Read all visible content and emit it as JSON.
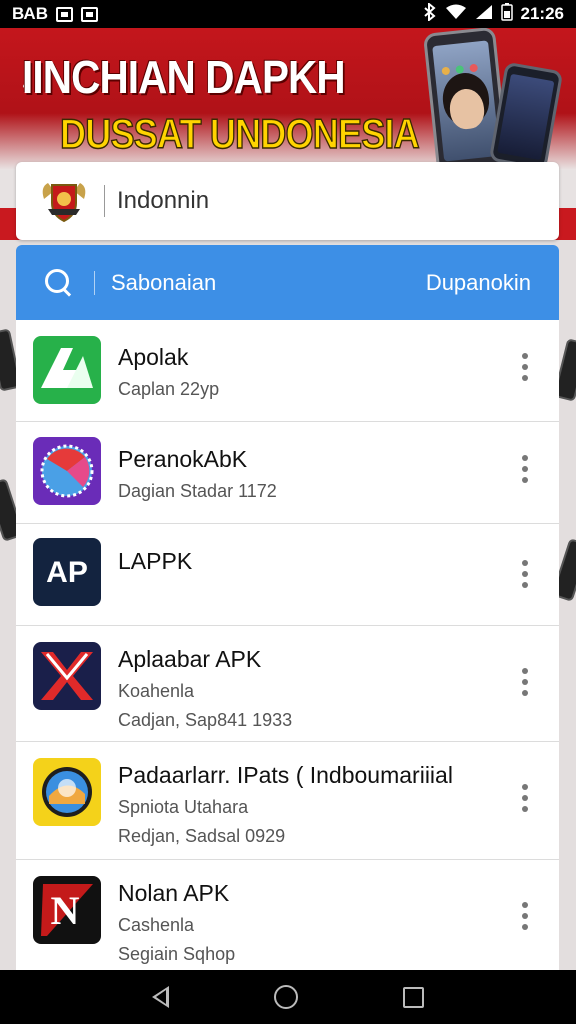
{
  "status_bar": {
    "left_text": "ВАВ",
    "time": "21:26",
    "icons": [
      "gallery-icon",
      "photo-icon",
      "bluetooth-icon",
      "wifi-icon",
      "signal-icon",
      "battery-icon"
    ]
  },
  "banner": {
    "title": "IINCHIAN DAPKH",
    "subtitle": "DUSSAT UNDONESIA",
    "colors": {
      "red": "#c4161c",
      "yellow": "#ffd400"
    }
  },
  "top_card": {
    "text": "Indonnin",
    "icon": "crest-icon"
  },
  "search_bar": {
    "label": "Sabonaian",
    "action": "Dupanokin",
    "color": "#3d8fe6"
  },
  "apps": [
    {
      "title": "Apolak",
      "line1": "Caplan 22yp",
      "line2": ""
    },
    {
      "title": "PeranokAbK",
      "line1": "Dagian Stadar 1172",
      "line2": ""
    },
    {
      "title": "LAPPK",
      "line1": "",
      "line2": ""
    },
    {
      "title": "Aplaabar APK",
      "line1": "Koahenla",
      "line2": "Cadjan, Sap841 1933"
    },
    {
      "title": "Padaarlarr. IPats ( Indboumariiial",
      "line1": "Spniota Utahara",
      "line2": "Redjan, Sadsal 0929"
    },
    {
      "title": "Nolan APK",
      "line1": "Cashenla",
      "line2": "Segiain Sqhop"
    }
  ],
  "nav": {
    "back": "back-icon",
    "home": "home-icon",
    "recent": "recent-apps-icon"
  }
}
